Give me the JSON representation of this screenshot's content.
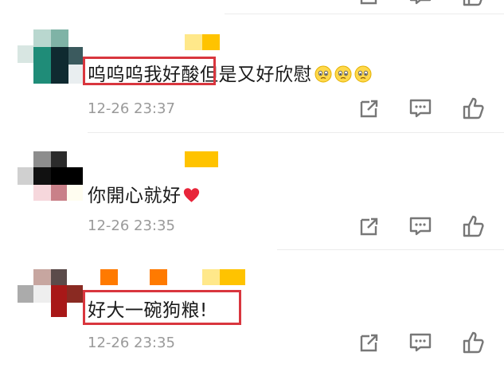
{
  "comments": [
    {
      "text_part1": "呜呜呜我好酸",
      "text_part2": "但是又好欣慰",
      "emoji": [
        "worried-face-emoji",
        "worried-face-emoji",
        "worried-face-emoji"
      ],
      "timestamp": "12-26 23:37"
    },
    {
      "text": "你開心就好",
      "emoji": [
        "red-heart-emoji"
      ],
      "timestamp": "12-26 23:35"
    },
    {
      "text": "好大一碗狗粮!",
      "timestamp": "12-26 23:35"
    }
  ],
  "icons": [
    "share-icon",
    "comment-icon",
    "like-icon"
  ],
  "colors": {
    "highlight_box": "#d9363e",
    "timestamp": "#9a9a9a",
    "icon": "#777777",
    "name_bar_yellow": "#ffc300",
    "name_bar_orange": "#ff7a00"
  }
}
